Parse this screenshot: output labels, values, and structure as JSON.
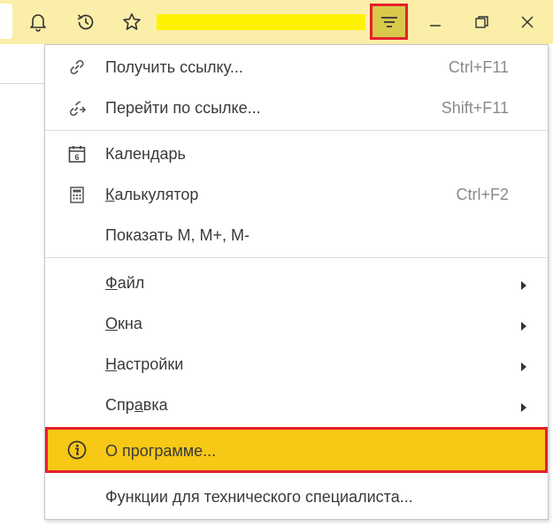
{
  "titlebar": {
    "icons": [
      "bell-icon",
      "history-icon",
      "star-icon",
      "menu-icon",
      "minimize-icon",
      "restore-icon",
      "close-icon"
    ],
    "accent": "#fbeea8",
    "highlight": "#e5202e"
  },
  "menu": {
    "items": [
      {
        "label_pre": "",
        "label_u": "",
        "label_post": "Получить ссылку...",
        "shortcut": "Ctrl+F11",
        "icon": "link-icon"
      },
      {
        "label_pre": "",
        "label_u": "",
        "label_post": "Перейти по ссылке...",
        "shortcut": "Shift+F11",
        "icon": "go-to-link-icon"
      },
      {
        "label_pre": "",
        "label_u": "",
        "label_post": "Календарь",
        "shortcut": "",
        "icon": "calendar-icon",
        "icon_text": "6"
      },
      {
        "label_pre": "",
        "label_u": "К",
        "label_post": "алькулятор",
        "shortcut": "Ctrl+F2",
        "icon": "calculator-icon"
      },
      {
        "label_pre": "",
        "label_u": "",
        "label_post": "Показать M, M+, M-",
        "shortcut": ""
      },
      {
        "label_pre": "",
        "label_u": "Ф",
        "label_post": "айл",
        "submenu": true
      },
      {
        "label_pre": "",
        "label_u": "О",
        "label_post": "кна",
        "submenu": true
      },
      {
        "label_pre": "",
        "label_u": "Н",
        "label_post": "астройки",
        "submenu": true
      },
      {
        "label_pre": "Спр",
        "label_u": "а",
        "label_post": "вка",
        "submenu": true
      },
      {
        "label_pre": "",
        "label_u": "",
        "label_post": "О программе...",
        "icon": "info-icon",
        "active": true,
        "active_color": "#f7c815"
      },
      {
        "label_pre": "",
        "label_u": "",
        "label_post": "Функции для технического специалиста..."
      }
    ]
  }
}
